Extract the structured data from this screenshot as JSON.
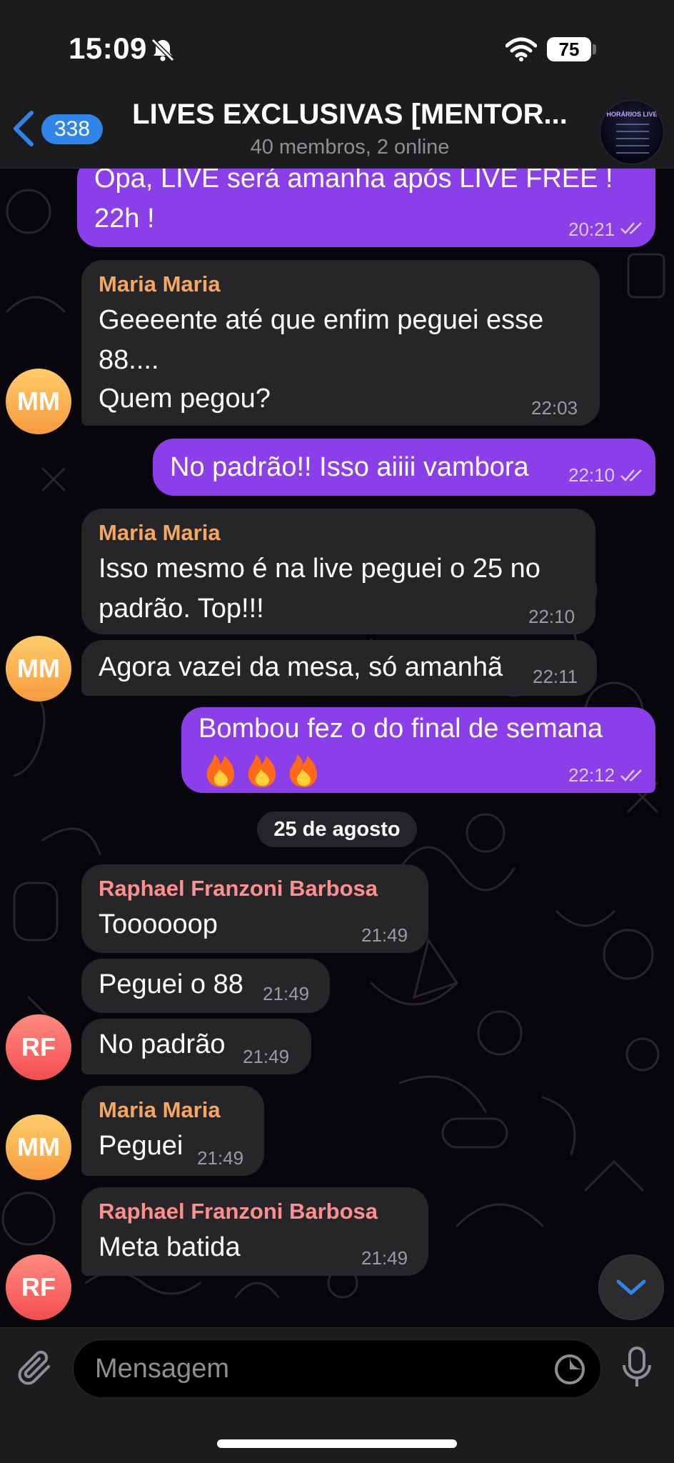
{
  "status_bar": {
    "time": "15:09",
    "battery": "75"
  },
  "header": {
    "back_count": "338",
    "title": "LIVES EXCLUSIVAS [MENTOR...",
    "subtitle": "40 membros, 2 online",
    "avatar_title": "HORÁRIOS LIVE"
  },
  "messages": [
    {
      "type": "out",
      "text1": "Opa, LIVE será amanha após LIVE FREE !",
      "text2": "22h !",
      "time": "20:21"
    },
    {
      "type": "in",
      "sender": "Maria Maria",
      "text1": "Geeeente até que enfim peguei esse",
      "text2": "88....",
      "text3": "Quem pegou?",
      "time": "22:03"
    },
    {
      "type": "out",
      "text1": "No padrão!!  Isso aiiii vambora",
      "time": "22:10"
    },
    {
      "type": "in",
      "sender": "Maria Maria",
      "text1": "Isso mesmo é na live peguei o 25 no",
      "text2": "padrão.  Top!!!",
      "time": "22:10"
    },
    {
      "type": "in",
      "text1": "Agora vazei da mesa, só amanhã",
      "time": "22:11"
    },
    {
      "type": "out",
      "text1": "Bombou fez o do final de semana",
      "emoji": "🔥🔥🔥",
      "time": "22:12"
    },
    {
      "type": "in",
      "sender": "Raphael Franzoni Barbosa",
      "text1": "Toooooop",
      "time": "21:49"
    },
    {
      "type": "in",
      "text1": "Peguei o 88",
      "time": "21:49"
    },
    {
      "type": "in",
      "text1": "No padrão",
      "time": "21:49"
    },
    {
      "type": "in",
      "sender": "Maria Maria",
      "text1": "Peguei",
      "time": "21:49"
    },
    {
      "type": "in",
      "sender": "Raphael Franzoni Barbosa",
      "text1": "Meta batida",
      "time": "21:49"
    }
  ],
  "date_separator": "25 de agosto",
  "avatars": {
    "maria": "MM",
    "raphael": "RF"
  },
  "input": {
    "placeholder": "Mensagem"
  },
  "colors": {
    "outgoing_bubble": "#8b3fe8",
    "incoming_bubble": "#262628",
    "badge": "#2f86e8",
    "maria_name": "#f5a661",
    "raphael_name": "#ff8f8f"
  }
}
